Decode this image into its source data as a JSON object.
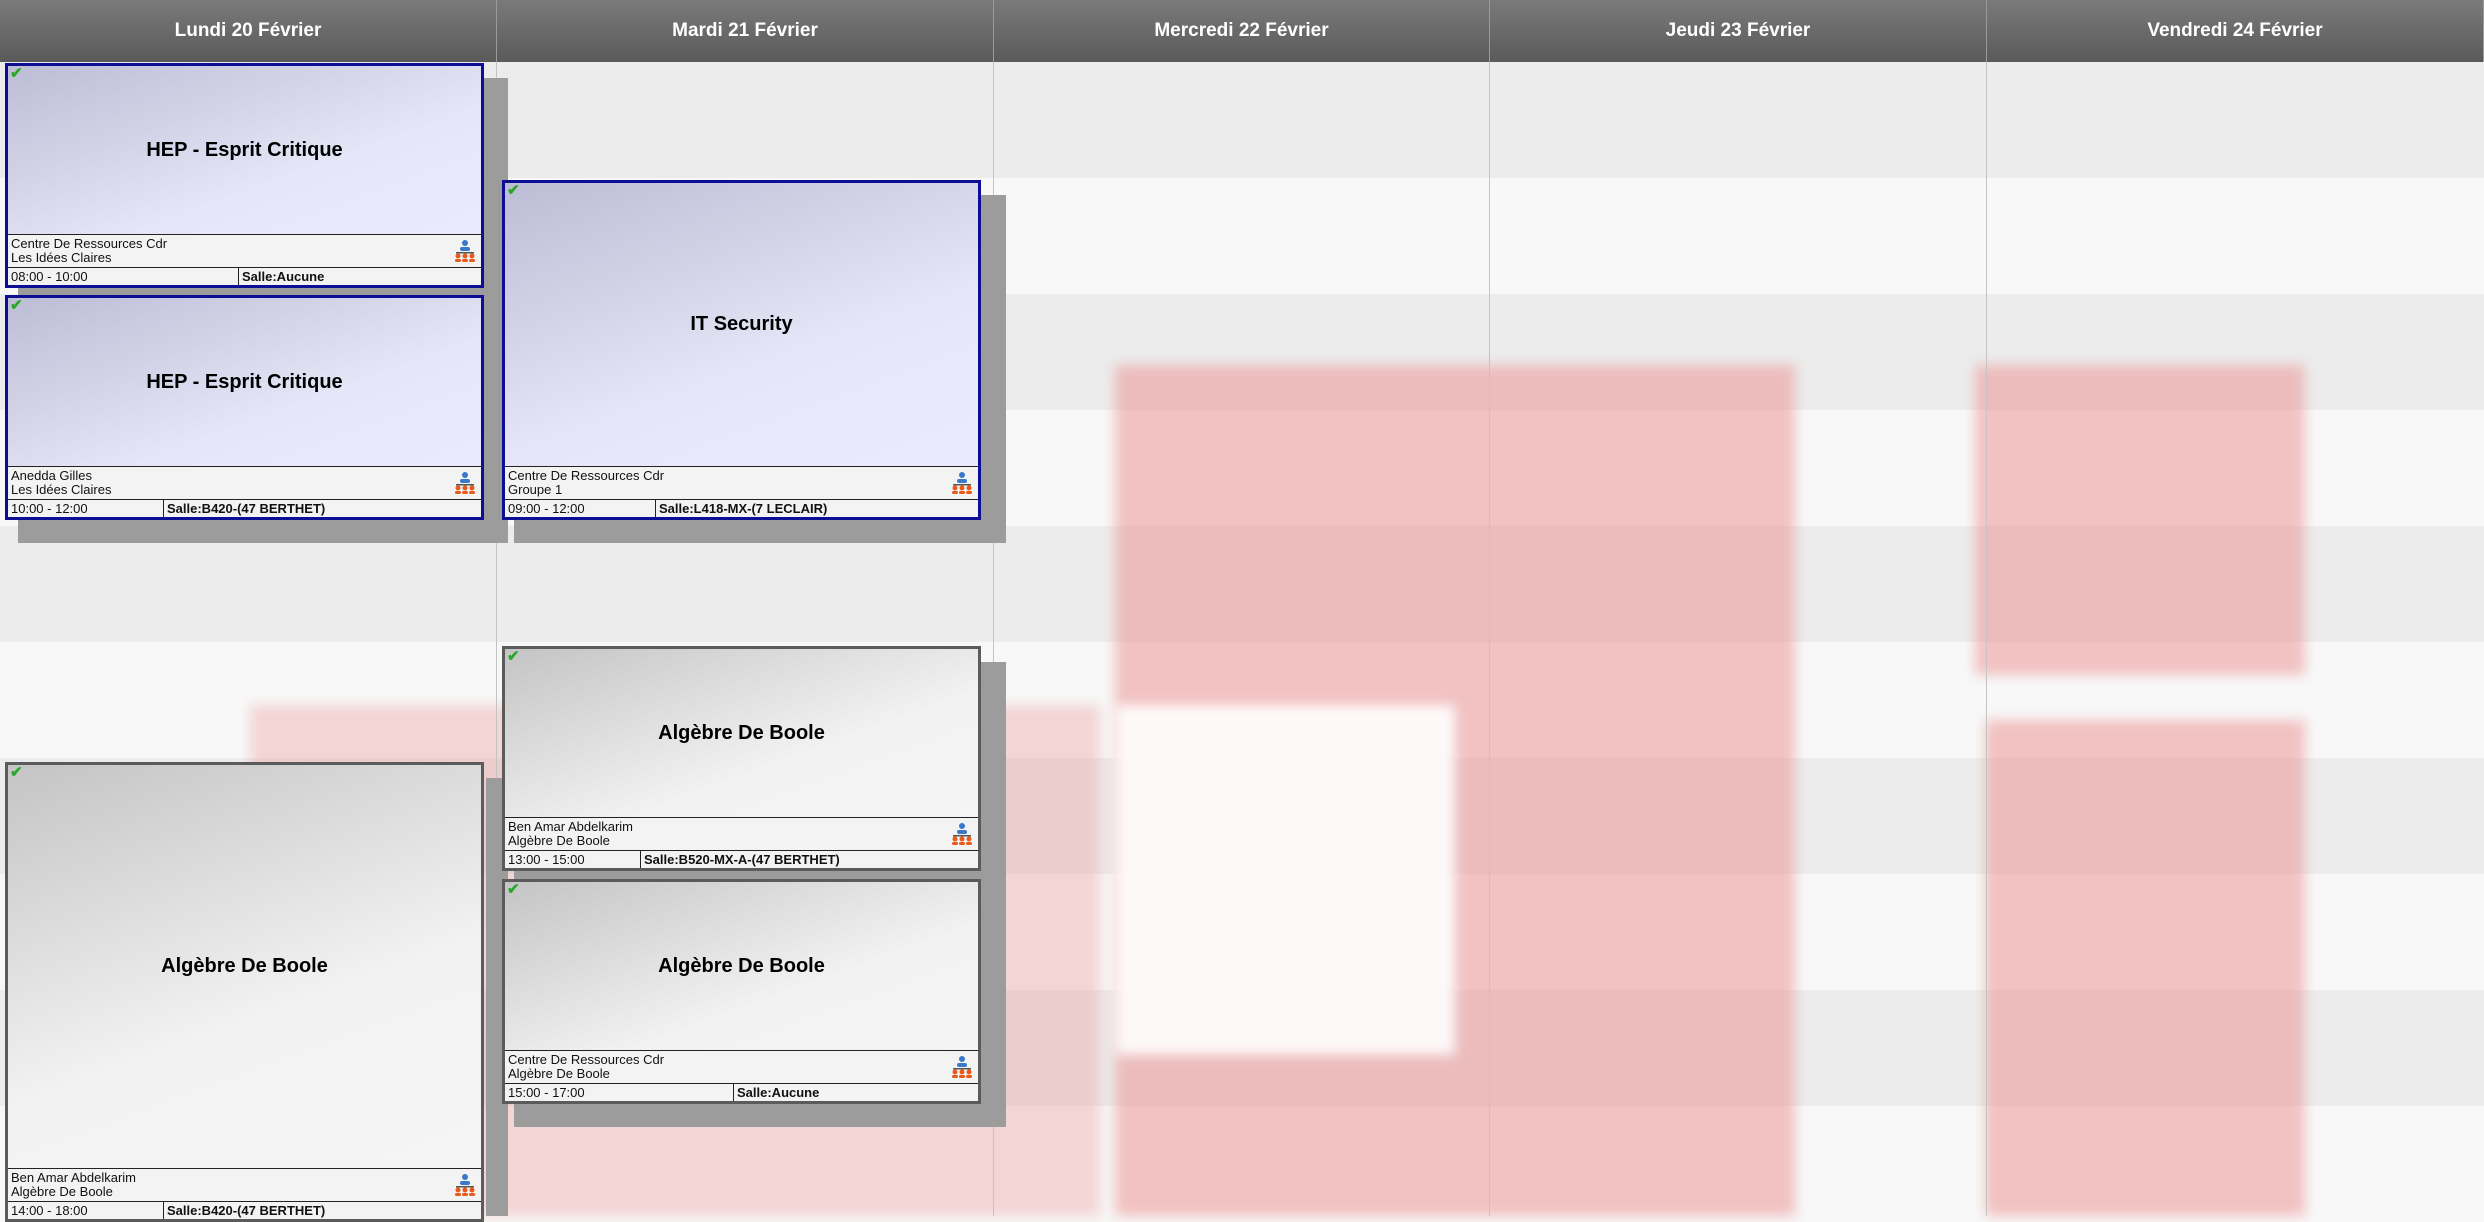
{
  "days": [
    {
      "label": "Lundi 20 Février"
    },
    {
      "label": "Mardi 21 Février"
    },
    {
      "label": "Mercredi 22 Février"
    },
    {
      "label": "Jeudi 23 Février"
    },
    {
      "label": "Vendredi 24 Février"
    }
  ],
  "events": [
    {
      "title": "HEP - Esprit Critique",
      "line1": "Centre De Ressources Cdr",
      "line2": "Les Idées Claires",
      "time": "08:00 - 10:00",
      "room": "Salle:Aucune",
      "status_icon": "check-icon",
      "group_icon": "group-icon"
    },
    {
      "title": "HEP - Esprit Critique",
      "line1": "Anedda Gilles",
      "line2": "Les Idées Claires",
      "time": "10:00 - 12:00",
      "room": "Salle:B420-(47 BERTHET)",
      "status_icon": "check-icon",
      "group_icon": "group-icon"
    },
    {
      "title": "IT Security",
      "line1": "Centre De Ressources Cdr",
      "line2": "Groupe 1",
      "time": "09:00 - 12:00",
      "room": "Salle:L418-MX-(7 LECLAIR)",
      "status_icon": "check-icon",
      "group_icon": "group-icon"
    },
    {
      "title": "Algèbre De Boole",
      "line1": "Ben Amar Abdelkarim",
      "line2": "Algèbre De Boole",
      "time": "13:00 - 15:00",
      "room": "Salle:B520-MX-A-(47 BERTHET)",
      "status_icon": "check-icon",
      "group_icon": "group-icon"
    },
    {
      "title": "Algèbre De Boole",
      "line1": "Centre De Ressources Cdr",
      "line2": "Algèbre De Boole",
      "time": "15:00 - 17:00",
      "room": "Salle:Aucune",
      "status_icon": "check-icon",
      "group_icon": "group-icon"
    },
    {
      "title": "Algèbre De Boole",
      "line1": "Ben Amar Abdelkarim",
      "line2": "Algèbre De Boole",
      "time": "14:00 - 18:00",
      "room": "Salle:B420-(47 BERTHET)",
      "status_icon": "check-icon",
      "group_icon": "group-icon"
    }
  ],
  "colors": {
    "header": "#666666",
    "event_border_blue": "#0d0d96",
    "event_border_grey": "#5b5b5b",
    "check": "#27a827"
  }
}
